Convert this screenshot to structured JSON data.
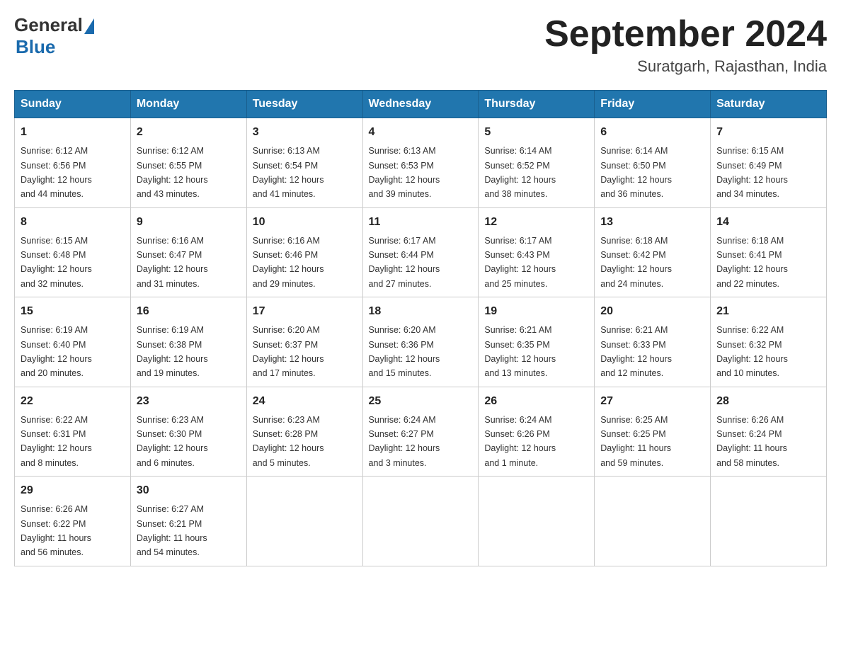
{
  "logo": {
    "general": "General",
    "blue": "Blue"
  },
  "title": "September 2024",
  "subtitle": "Suratgarh, Rajasthan, India",
  "days_of_week": [
    "Sunday",
    "Monday",
    "Tuesday",
    "Wednesday",
    "Thursday",
    "Friday",
    "Saturday"
  ],
  "weeks": [
    [
      {
        "day": "1",
        "sunrise": "6:12 AM",
        "sunset": "6:56 PM",
        "daylight": "12 hours and 44 minutes."
      },
      {
        "day": "2",
        "sunrise": "6:12 AM",
        "sunset": "6:55 PM",
        "daylight": "12 hours and 43 minutes."
      },
      {
        "day": "3",
        "sunrise": "6:13 AM",
        "sunset": "6:54 PM",
        "daylight": "12 hours and 41 minutes."
      },
      {
        "day": "4",
        "sunrise": "6:13 AM",
        "sunset": "6:53 PM",
        "daylight": "12 hours and 39 minutes."
      },
      {
        "day": "5",
        "sunrise": "6:14 AM",
        "sunset": "6:52 PM",
        "daylight": "12 hours and 38 minutes."
      },
      {
        "day": "6",
        "sunrise": "6:14 AM",
        "sunset": "6:50 PM",
        "daylight": "12 hours and 36 minutes."
      },
      {
        "day": "7",
        "sunrise": "6:15 AM",
        "sunset": "6:49 PM",
        "daylight": "12 hours and 34 minutes."
      }
    ],
    [
      {
        "day": "8",
        "sunrise": "6:15 AM",
        "sunset": "6:48 PM",
        "daylight": "12 hours and 32 minutes."
      },
      {
        "day": "9",
        "sunrise": "6:16 AM",
        "sunset": "6:47 PM",
        "daylight": "12 hours and 31 minutes."
      },
      {
        "day": "10",
        "sunrise": "6:16 AM",
        "sunset": "6:46 PM",
        "daylight": "12 hours and 29 minutes."
      },
      {
        "day": "11",
        "sunrise": "6:17 AM",
        "sunset": "6:44 PM",
        "daylight": "12 hours and 27 minutes."
      },
      {
        "day": "12",
        "sunrise": "6:17 AM",
        "sunset": "6:43 PM",
        "daylight": "12 hours and 25 minutes."
      },
      {
        "day": "13",
        "sunrise": "6:18 AM",
        "sunset": "6:42 PM",
        "daylight": "12 hours and 24 minutes."
      },
      {
        "day": "14",
        "sunrise": "6:18 AM",
        "sunset": "6:41 PM",
        "daylight": "12 hours and 22 minutes."
      }
    ],
    [
      {
        "day": "15",
        "sunrise": "6:19 AM",
        "sunset": "6:40 PM",
        "daylight": "12 hours and 20 minutes."
      },
      {
        "day": "16",
        "sunrise": "6:19 AM",
        "sunset": "6:38 PM",
        "daylight": "12 hours and 19 minutes."
      },
      {
        "day": "17",
        "sunrise": "6:20 AM",
        "sunset": "6:37 PM",
        "daylight": "12 hours and 17 minutes."
      },
      {
        "day": "18",
        "sunrise": "6:20 AM",
        "sunset": "6:36 PM",
        "daylight": "12 hours and 15 minutes."
      },
      {
        "day": "19",
        "sunrise": "6:21 AM",
        "sunset": "6:35 PM",
        "daylight": "12 hours and 13 minutes."
      },
      {
        "day": "20",
        "sunrise": "6:21 AM",
        "sunset": "6:33 PM",
        "daylight": "12 hours and 12 minutes."
      },
      {
        "day": "21",
        "sunrise": "6:22 AM",
        "sunset": "6:32 PM",
        "daylight": "12 hours and 10 minutes."
      }
    ],
    [
      {
        "day": "22",
        "sunrise": "6:22 AM",
        "sunset": "6:31 PM",
        "daylight": "12 hours and 8 minutes."
      },
      {
        "day": "23",
        "sunrise": "6:23 AM",
        "sunset": "6:30 PM",
        "daylight": "12 hours and 6 minutes."
      },
      {
        "day": "24",
        "sunrise": "6:23 AM",
        "sunset": "6:28 PM",
        "daylight": "12 hours and 5 minutes."
      },
      {
        "day": "25",
        "sunrise": "6:24 AM",
        "sunset": "6:27 PM",
        "daylight": "12 hours and 3 minutes."
      },
      {
        "day": "26",
        "sunrise": "6:24 AM",
        "sunset": "6:26 PM",
        "daylight": "12 hours and 1 minute."
      },
      {
        "day": "27",
        "sunrise": "6:25 AM",
        "sunset": "6:25 PM",
        "daylight": "11 hours and 59 minutes."
      },
      {
        "day": "28",
        "sunrise": "6:26 AM",
        "sunset": "6:24 PM",
        "daylight": "11 hours and 58 minutes."
      }
    ],
    [
      {
        "day": "29",
        "sunrise": "6:26 AM",
        "sunset": "6:22 PM",
        "daylight": "11 hours and 56 minutes."
      },
      {
        "day": "30",
        "sunrise": "6:27 AM",
        "sunset": "6:21 PM",
        "daylight": "11 hours and 54 minutes."
      },
      null,
      null,
      null,
      null,
      null
    ]
  ],
  "labels": {
    "sunrise": "Sunrise:",
    "sunset": "Sunset:",
    "daylight": "Daylight:"
  }
}
